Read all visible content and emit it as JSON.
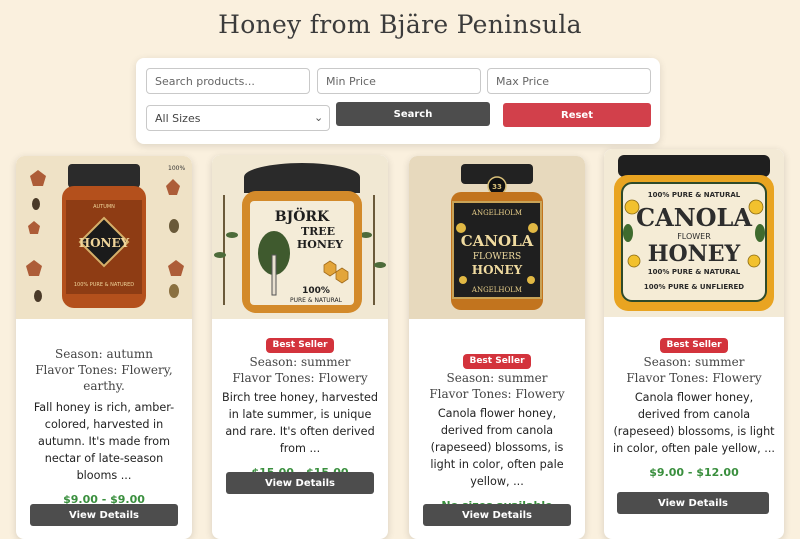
{
  "page": {
    "title": "Honey from Bjäre Peninsula"
  },
  "filters": {
    "search_placeholder": "Search products...",
    "min_price_placeholder": "Min Price",
    "max_price_placeholder": "Max Price",
    "size_selected": "All Sizes",
    "search_label": "Search",
    "reset_label": "Reset"
  },
  "products": [
    {
      "image_text": [
        "HONEY",
        "100% PURE & NATURED",
        "AUTUMN",
        "100%"
      ],
      "badge": "",
      "season": "Season: autumn",
      "flavor": "Flavor Tones: Flowery, earthy.",
      "description": "Fall honey is rich, amber-colored, harvested in autumn. It's made from nectar of late-season blooms ...",
      "price": "$9.00 - $9.00",
      "button": "View Details"
    },
    {
      "image_text": [
        "BJÖRK",
        "TREE",
        "HONEY",
        "100%",
        "PURE & NATURAL"
      ],
      "badge": "Best Seller",
      "season": "Season: summer",
      "flavor": "Flavor Tones: Flowery",
      "description": "Birch tree honey, harvested in late summer, is unique and rare. It's often derived from ...",
      "price": "$15.00 - $15.00",
      "button": "View Details"
    },
    {
      "image_text": [
        "33",
        "ANGELHOLM",
        "CANOLA",
        "FLOWERS",
        "HONEY",
        "ANGELHOLM"
      ],
      "badge": "Best Seller",
      "season": "Season: summer",
      "flavor": "Flavor Tones: Flowery",
      "description": "Canola flower honey, derived from canola (rapeseed) blossoms, is light in color, often pale yellow, ...",
      "price": "No sizes available",
      "button": "View Details"
    },
    {
      "image_text": [
        "100% PURE & NATURAL",
        "CANOLA",
        "FLOWER",
        "HONEY",
        "100% PURE & NATURAL",
        "100% PURE & UNFLIERED"
      ],
      "badge": "Best Seller",
      "season": "Season: summer",
      "flavor": "Flavor Tones: Flowery",
      "description": "Canola flower honey, derived from canola (rapeseed) blossoms, is light in color, often pale yellow, ...",
      "price": "$9.00 - $12.00",
      "button": "View Details"
    }
  ],
  "colors": {
    "background": "#faf0de",
    "accent_green": "#3a8f3e",
    "badge_red": "#d3333c",
    "reset_red": "#d2404b",
    "button_dark": "#4d4d4d"
  }
}
